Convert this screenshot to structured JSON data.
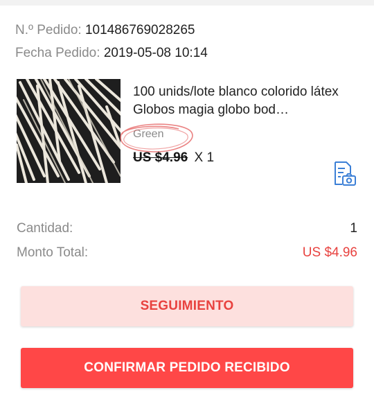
{
  "order": {
    "number_label": "N.º Pedido:",
    "number_value": "101486769028265",
    "date_label": "Fecha Pedido:",
    "date_value": "2019-05-08 10:14"
  },
  "product": {
    "title": "100 unids/lote blanco colorido látex Globos magia globo bod…",
    "variant": "Green",
    "price": "US $4.96",
    "quantity": "X 1",
    "image_icon": "balloon-sticks-photo",
    "action_icon": "document-photo-icon"
  },
  "summary": {
    "quantity_label": "Cantidad:",
    "quantity_value": "1",
    "total_label": "Monto Total:",
    "total_value": "US $4.96"
  },
  "buttons": {
    "tracking": "SEGUIMIENTO",
    "confirm": "CONFIRMAR PEDIDO RECIBIDO"
  },
  "colors": {
    "accent": "#ff4747",
    "accent_text": "#e8423f",
    "accent_light": "#fde0de",
    "icon_blue": "#3b7fd6"
  }
}
